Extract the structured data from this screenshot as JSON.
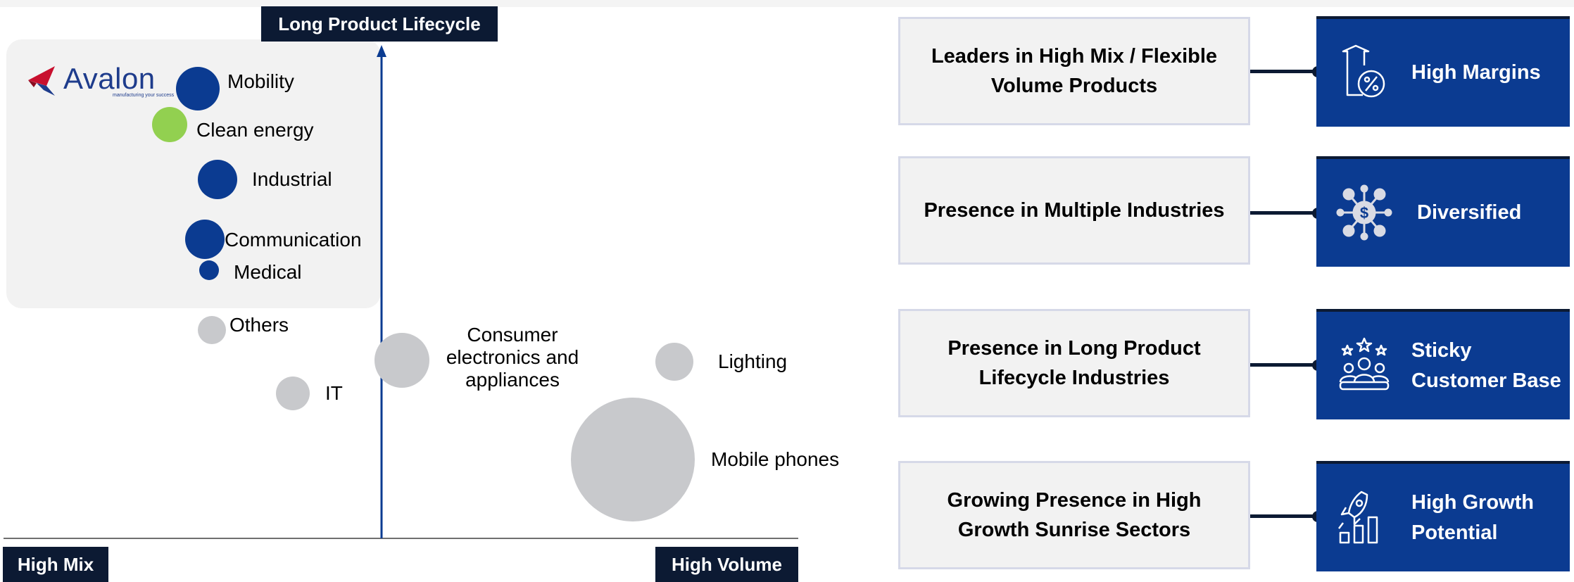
{
  "diagram": {
    "axis_top_label": "Long Product Lifecycle",
    "axis_left_label": "High Mix",
    "axis_right_label": "High Volume",
    "logo": {
      "name": "Avalon",
      "tagline": "manufacturing your success"
    },
    "bubbles": [
      {
        "label": "Mobility",
        "color": "#0b3b91"
      },
      {
        "label": "Clean energy",
        "color": "#92d050"
      },
      {
        "label": "Industrial",
        "color": "#0b3b91"
      },
      {
        "label": "Communication",
        "color": "#0b3b91"
      },
      {
        "label": "Medical",
        "color": "#0b3b91"
      },
      {
        "label": "Others",
        "color": "#c8c9cc"
      },
      {
        "label": "IT",
        "color": "#c8c9cc"
      },
      {
        "label": "Consumer electronics and appliances",
        "color": "#c8c9cc"
      },
      {
        "label": "Lighting",
        "color": "#c8c9cc"
      },
      {
        "label": "Mobile phones",
        "color": "#c8c9cc"
      }
    ]
  },
  "rows": [
    {
      "left": "Leaders in High Mix / Flexible Volume Products",
      "right": "High Margins",
      "icon": "house-percent-icon"
    },
    {
      "left": "Presence in Multiple Industries",
      "right": "Diversified",
      "icon": "dollar-network-icon"
    },
    {
      "left": "Presence in Long Product Lifecycle Industries",
      "right": "Sticky Customer Base",
      "icon": "customers-stars-icon"
    },
    {
      "left": "Growing Presence in High Growth Sunrise Sectors",
      "right": "High Growth Potential",
      "icon": "rocket-bars-icon"
    }
  ],
  "colors": {
    "navy": "#0b3b91",
    "dark": "#0c1a33",
    "green": "#92d050",
    "grey": "#c8c9cc",
    "panel": "#f2f2f2"
  }
}
